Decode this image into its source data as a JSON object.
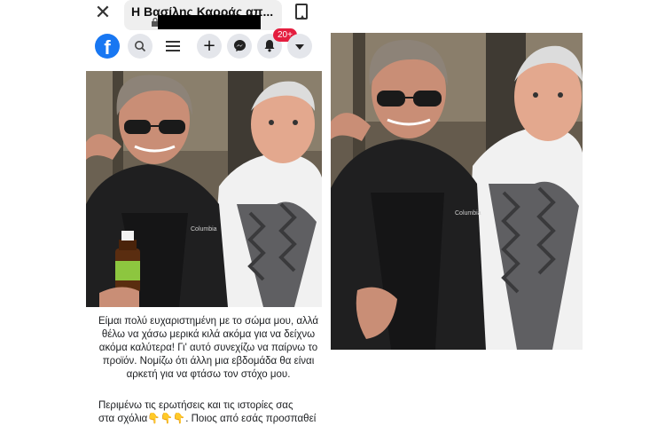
{
  "header": {
    "title": "Η Βασίλης Καρράς απ...",
    "close_icon": "close-icon",
    "bookmark_icon": "bookmark-icon"
  },
  "navbar": {
    "logo": "f",
    "notifications_badge": "20+",
    "icons": [
      "search-icon",
      "menu-icon",
      "plus-icon",
      "messenger-icon",
      "bell-icon",
      "caret-down-icon"
    ]
  },
  "post": {
    "paragraph1": "Είμαι πολύ ευχαριστημένη με το σώμα μου, αλλά θέλω να χάσω μερικά κιλά ακόμα για να δείχνω ακόμα καλύτερα! Γι' αυτό συνεχίζω να παίρνω το προϊόν. Νομίζω ότι άλλη μια εβδομάδα θα είναι αρκετή για να φτάσω τον στόχο μου.",
    "paragraph2_line1": "Περιμένω τις ερωτήσεις και τις ιστορίες σας",
    "paragraph2_line2": "στα σχόλια👇👇👇. Ποιος από εσάς προσπαθεί"
  },
  "photo": {
    "jacket_brand": "Columbia"
  },
  "colors": {
    "facebook_blue": "#1877f2",
    "badge_red": "#e41e3f"
  }
}
